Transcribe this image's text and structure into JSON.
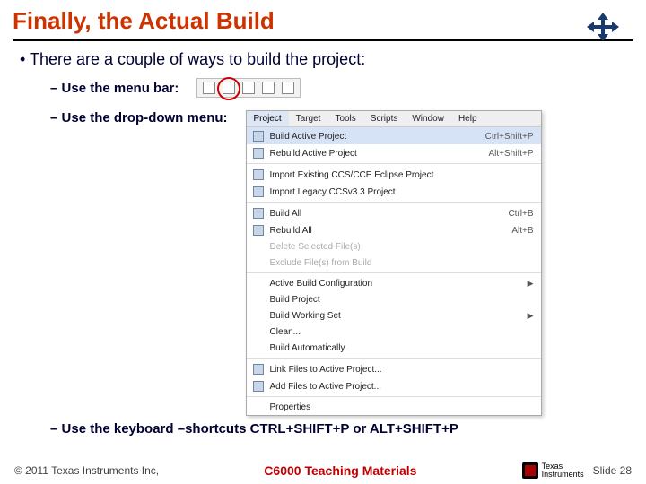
{
  "title": "Finally, the Actual Build",
  "bullet": "There are a couple of ways to build the project:",
  "sub1": "Use the menu bar:",
  "sub2": "Use the drop-down menu:",
  "sub3": "Use the keyboard –shortcuts CTRL+SHIFT+P or ALT+SHIFT+P",
  "menubar": {
    "items": [
      {
        "label": "Project",
        "active": true
      },
      {
        "label": "Target"
      },
      {
        "label": "Tools"
      },
      {
        "label": "Scripts"
      },
      {
        "label": "Window"
      },
      {
        "label": "Help"
      }
    ]
  },
  "menu": [
    {
      "type": "item",
      "label": "Build Active Project",
      "shortcut": "Ctrl+Shift+P",
      "icon": true,
      "highlight": true
    },
    {
      "type": "item",
      "label": "Rebuild Active Project",
      "shortcut": "Alt+Shift+P",
      "icon": true
    },
    {
      "type": "sep"
    },
    {
      "type": "item",
      "label": "Import Existing CCS/CCE Eclipse Project",
      "icon": true
    },
    {
      "type": "item",
      "label": "Import Legacy CCSv3.3 Project",
      "icon": true
    },
    {
      "type": "sep"
    },
    {
      "type": "item",
      "label": "Build All",
      "shortcut": "Ctrl+B",
      "icon": true
    },
    {
      "type": "item",
      "label": "Rebuild All",
      "shortcut": "Alt+B",
      "icon": true
    },
    {
      "type": "item",
      "label": "Delete Selected File(s)",
      "disabled": true
    },
    {
      "type": "item",
      "label": "Exclude File(s) from Build",
      "disabled": true
    },
    {
      "type": "sep"
    },
    {
      "type": "item",
      "label": "Active Build Configuration",
      "submenu": true
    },
    {
      "type": "item",
      "label": "Build Project"
    },
    {
      "type": "item",
      "label": "Build Working Set",
      "submenu": true
    },
    {
      "type": "item",
      "label": "Clean..."
    },
    {
      "type": "item",
      "label": "Build Automatically"
    },
    {
      "type": "sep"
    },
    {
      "type": "item",
      "label": "Link Files to Active Project...",
      "icon": true
    },
    {
      "type": "item",
      "label": "Add Files to Active Project...",
      "icon": true
    },
    {
      "type": "sep"
    },
    {
      "type": "item",
      "label": "Properties"
    }
  ],
  "footer": {
    "copyright": "© 2011 Texas Instruments Inc,",
    "center": "C6000 Teaching Materials",
    "ti_name": "Texas\nInstruments",
    "slide": "Slide 28"
  }
}
